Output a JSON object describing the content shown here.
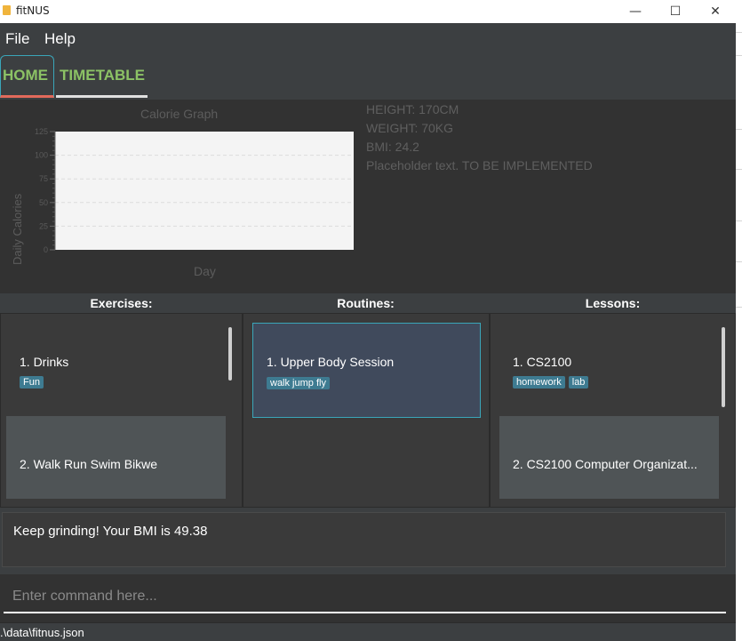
{
  "window": {
    "title": "fitNUS",
    "minimize_glyph": "—",
    "maximize_glyph": "☐",
    "close_glyph": "✕"
  },
  "menu": {
    "file": "File",
    "help": "Help"
  },
  "tabs": {
    "home": "HOME",
    "timetable": "TIMETABLE"
  },
  "chart_data": {
    "type": "line",
    "title": "Calorie Graph",
    "xlabel": "Day",
    "ylabel": "Daily Calories",
    "ylim": [
      0,
      125
    ],
    "yticks": [
      0,
      25,
      50,
      75,
      100,
      125
    ],
    "x": [],
    "values": [],
    "grid": true
  },
  "stats": {
    "height": "HEIGHT: 170CM",
    "weight": "WEIGHT: 70KG",
    "bmi": "BMI: 24.2",
    "placeholder": "Placeholder text. TO BE IMPLEMENTED"
  },
  "exercises": {
    "header": "Exercises:",
    "items": [
      {
        "label": "1.  Drinks",
        "tags": [
          "Fun"
        ]
      },
      {
        "label": "2.  Walk Run Swim Bikwe",
        "tags": []
      }
    ]
  },
  "routines": {
    "header": "Routines:",
    "items": [
      {
        "label": "1.  Upper Body Session",
        "tags": [
          "walk jump fly"
        ]
      }
    ]
  },
  "lessons": {
    "header": "Lessons:",
    "items": [
      {
        "label": "1.  CS2100",
        "tags": [
          "homework",
          "lab"
        ]
      },
      {
        "label": "2.  CS2100 Computer Organizat...",
        "tags": []
      }
    ]
  },
  "result": {
    "text": "Keep grinding! Your BMI is 49.38"
  },
  "command": {
    "value": "",
    "placeholder": "Enter command here..."
  },
  "status": {
    "path": ".\\data\\fitnus.json"
  },
  "colors": {
    "background": "#3c3f41",
    "tab_text": "#8cc265",
    "tab_active_underline": "#e26a5b",
    "tag_bg": "#3e7b91",
    "selected_card": "#404a5c"
  }
}
